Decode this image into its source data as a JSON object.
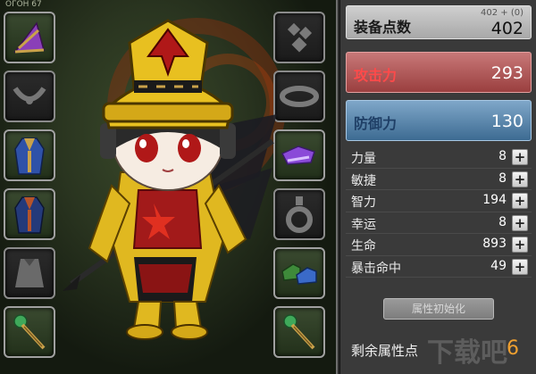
{
  "hud_overlay": "ОГОН 67",
  "equipment": {
    "left_slots": [
      {
        "name": "hat",
        "state": "filled",
        "icon": "purple-hat-icon"
      },
      {
        "name": "necklace",
        "state": "empty",
        "icon": "necklace-slot-icon"
      },
      {
        "name": "top",
        "state": "filled",
        "icon": "robe-icon"
      },
      {
        "name": "bottom",
        "state": "filled",
        "icon": "dark-robe-icon"
      },
      {
        "name": "cape",
        "state": "empty",
        "icon": "cape-slot-icon"
      },
      {
        "name": "weapon",
        "state": "filled",
        "icon": "staff-icon"
      }
    ],
    "right_slots": [
      {
        "name": "earring",
        "state": "empty",
        "icon": "earring-slot-icon"
      },
      {
        "name": "belt",
        "state": "empty",
        "icon": "belt-slot-icon"
      },
      {
        "name": "gloves",
        "state": "filled",
        "icon": "purple-gloves-icon"
      },
      {
        "name": "ring",
        "state": "empty",
        "icon": "ring-slot-icon"
      },
      {
        "name": "shoes",
        "state": "filled",
        "icon": "green-shoes-icon"
      },
      {
        "name": "secondary-weapon",
        "state": "filled",
        "icon": "staff-icon"
      }
    ]
  },
  "stats_panel": {
    "equip_points": {
      "label": "装备点数",
      "sub": "402 + (0)",
      "value": "402"
    },
    "attack": {
      "label": "攻击力",
      "value": "293"
    },
    "defense": {
      "label": "防御力",
      "value": "130"
    },
    "attributes": [
      {
        "name": "力量",
        "value": "8",
        "plus": "+"
      },
      {
        "name": "敏捷",
        "value": "8",
        "plus": "+"
      },
      {
        "name": "智力",
        "value": "194",
        "plus": "+"
      },
      {
        "name": "幸运",
        "value": "8",
        "plus": "+"
      },
      {
        "name": "生命",
        "value": "893",
        "plus": "+"
      },
      {
        "name": "暴击命中",
        "value": "49",
        "plus": "+"
      }
    ],
    "reset_button": "属性初始化",
    "remaining": {
      "label": "剩余属性点",
      "value": "6"
    }
  },
  "watermark": "下载吧",
  "colors": {
    "attack_label": "#ff4a4a",
    "defense_label": "#1f3f66",
    "remaining_value": "#f0a030"
  }
}
